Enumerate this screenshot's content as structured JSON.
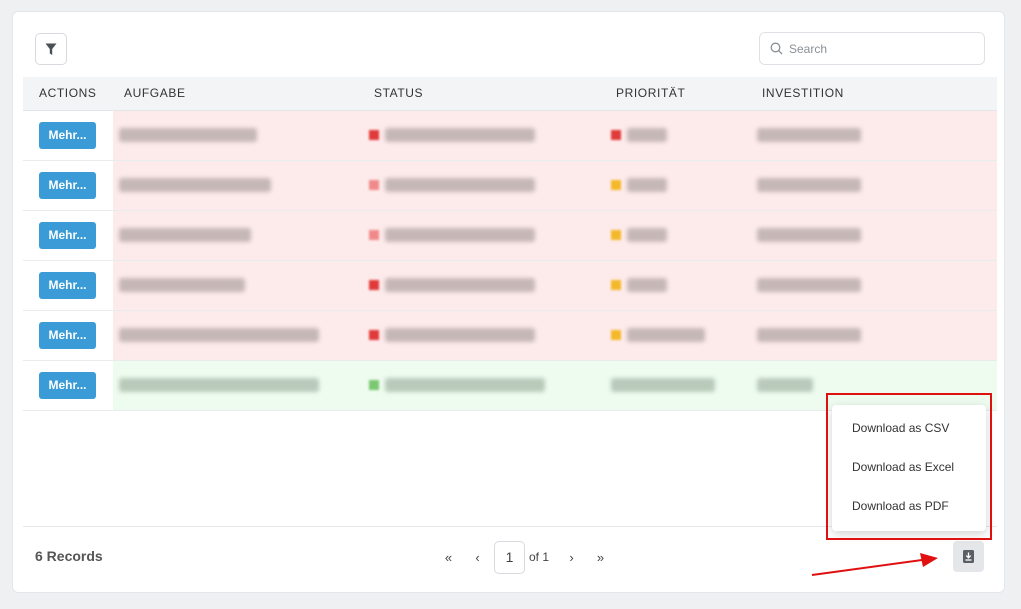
{
  "toolbar": {
    "search_placeholder": "Search",
    "filter_icon": "filter-icon",
    "search_icon": "search-icon"
  },
  "table": {
    "headers": {
      "actions": "ACTIONS",
      "aufgabe": "AUFGABE",
      "status": "STATUS",
      "prioritaet": "PRIORITÄT",
      "investition": "INVESTITION"
    },
    "rows": [
      {
        "action_label": "Mehr...",
        "row_color": "#fdeaea",
        "status_dot": "#e03a3a",
        "prio_dot": "#e03a3a"
      },
      {
        "action_label": "Mehr...",
        "row_color": "#fdeaea",
        "status_dot": "#f08a8a",
        "prio_dot": "#f5b82a"
      },
      {
        "action_label": "Mehr...",
        "row_color": "#fdeaea",
        "status_dot": "#f08a8a",
        "prio_dot": "#f5b82a"
      },
      {
        "action_label": "Mehr...",
        "row_color": "#fdeaea",
        "status_dot": "#e03a3a",
        "prio_dot": "#f5b82a"
      },
      {
        "action_label": "Mehr...",
        "row_color": "#fdeaea",
        "status_dot": "#e03a3a",
        "prio_dot": "#f5b82a"
      },
      {
        "action_label": "Mehr...",
        "row_color": "#eefbef",
        "status_dot": "#7ac870",
        "prio_dot": "#b9c0b9"
      }
    ]
  },
  "download_menu": {
    "items": [
      "Download as CSV",
      "Download as Excel",
      "Download as PDF"
    ]
  },
  "footer": {
    "records": "6 Records",
    "first": "«",
    "prev": "‹",
    "page": "1",
    "of": "of 1",
    "next": "›",
    "last": "»",
    "download_icon": "download-icon"
  },
  "colors": {
    "accent": "#3a9bd6",
    "highlight": "#e01010"
  }
}
